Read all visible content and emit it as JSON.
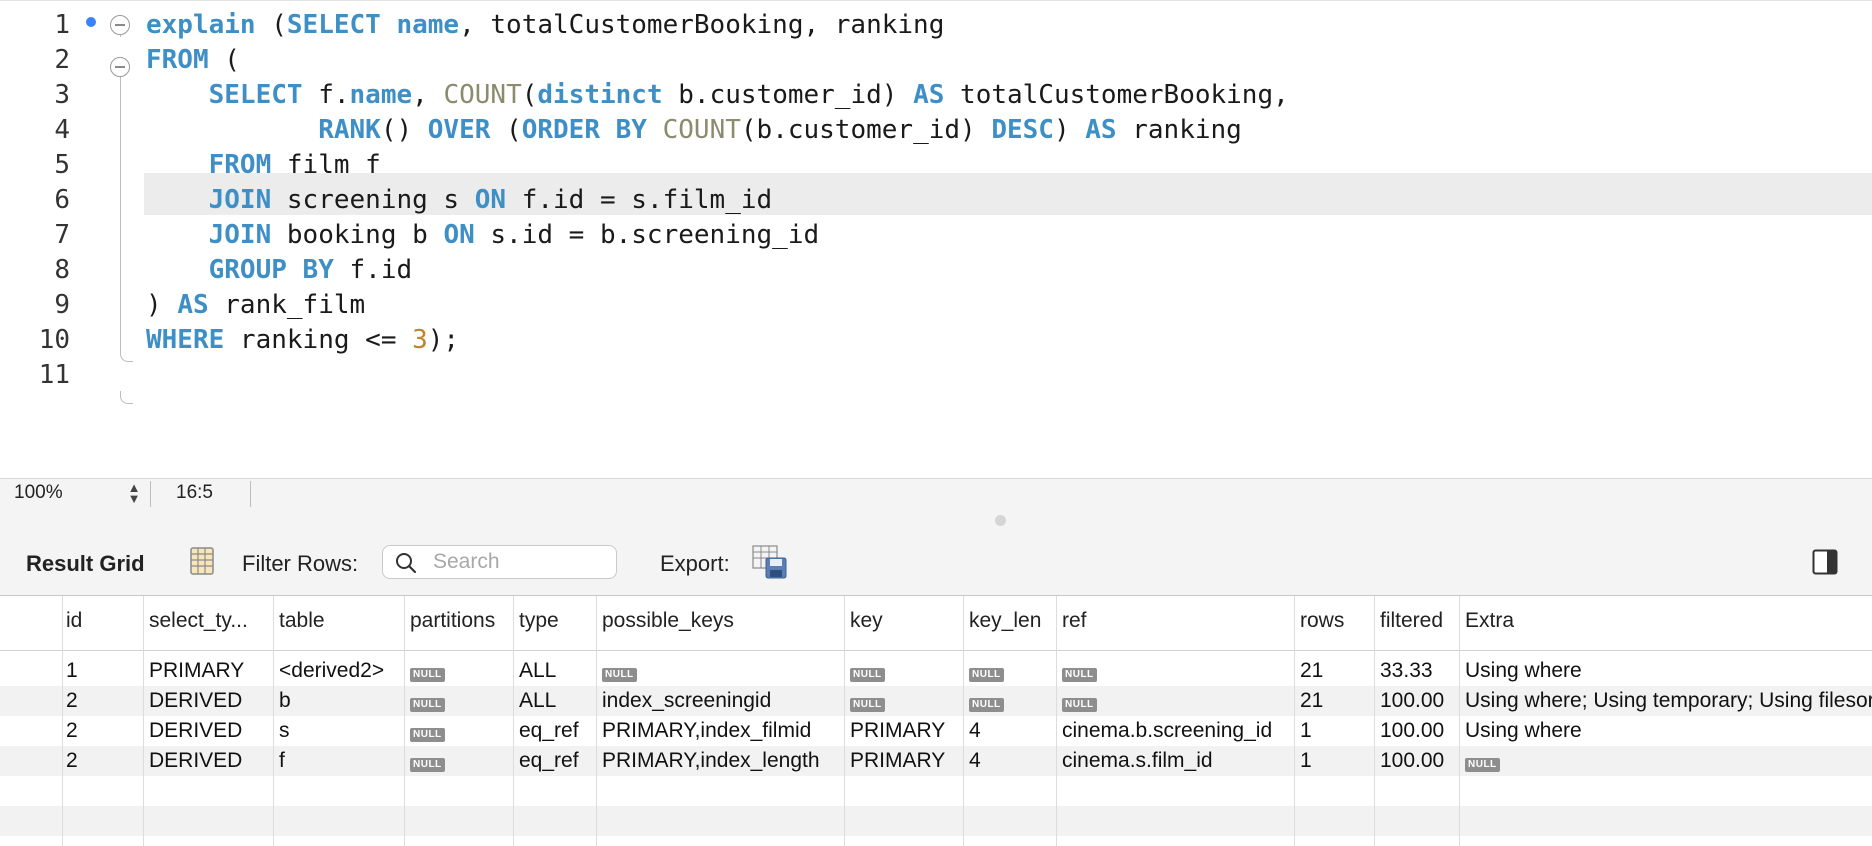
{
  "editor": {
    "line_numbers": [
      "1",
      "2",
      "3",
      "4",
      "5",
      "6",
      "7",
      "8",
      "9",
      "10",
      "11"
    ],
    "lines": [
      [
        {
          "t": "explain",
          "c": "kw"
        },
        {
          "t": " ("
        },
        {
          "t": "SELECT",
          "c": "kw"
        },
        {
          "t": " "
        },
        {
          "t": "name",
          "c": "kw"
        },
        {
          "t": ", totalCustomerBooking, ranking"
        }
      ],
      [
        {
          "t": "FROM",
          "c": "kw"
        },
        {
          "t": " ("
        }
      ],
      [
        {
          "t": "    "
        },
        {
          "t": "SELECT",
          "c": "kw"
        },
        {
          "t": " f."
        },
        {
          "t": "name",
          "c": "kw"
        },
        {
          "t": ", "
        },
        {
          "t": "COUNT",
          "c": "fn"
        },
        {
          "t": "("
        },
        {
          "t": "distinct",
          "c": "kw"
        },
        {
          "t": " b.customer_id) "
        },
        {
          "t": "AS",
          "c": "kw"
        },
        {
          "t": " totalCustomerBooking,"
        }
      ],
      [
        {
          "t": "           "
        },
        {
          "t": "RANK",
          "c": "kw"
        },
        {
          "t": "() "
        },
        {
          "t": "OVER",
          "c": "kw"
        },
        {
          "t": " ("
        },
        {
          "t": "ORDER BY",
          "c": "kw"
        },
        {
          "t": " "
        },
        {
          "t": "COUNT",
          "c": "fn"
        },
        {
          "t": "(b.customer_id) "
        },
        {
          "t": "DESC",
          "c": "kw"
        },
        {
          "t": ") "
        },
        {
          "t": "AS",
          "c": "kw"
        },
        {
          "t": " ranking"
        }
      ],
      [
        {
          "t": "    "
        },
        {
          "t": "FROM",
          "c": "kw"
        },
        {
          "t": " film f"
        }
      ],
      [
        {
          "t": "    "
        },
        {
          "t": "JOIN",
          "c": "kw"
        },
        {
          "t": " screening s "
        },
        {
          "t": "ON",
          "c": "kw"
        },
        {
          "t": " f.id = s.film_id"
        }
      ],
      [
        {
          "t": "    "
        },
        {
          "t": "JOIN",
          "c": "kw"
        },
        {
          "t": " booking b "
        },
        {
          "t": "ON",
          "c": "kw"
        },
        {
          "t": " s.id = b.screening_id"
        }
      ],
      [
        {
          "t": "    "
        },
        {
          "t": "GROUP BY",
          "c": "kw"
        },
        {
          "t": " f.id"
        }
      ],
      [
        {
          "t": ") "
        },
        {
          "t": "AS",
          "c": "kw"
        },
        {
          "t": " rank_film"
        }
      ],
      [
        {
          "t": "WHERE",
          "c": "kw"
        },
        {
          "t": " ranking <= "
        },
        {
          "t": "3",
          "c": "num"
        },
        {
          "t": ");"
        }
      ],
      []
    ]
  },
  "status": {
    "zoom": "100%",
    "cursor": "16:5"
  },
  "result_toolbar": {
    "title": "Result Grid",
    "filter_label": "Filter Rows:",
    "search_placeholder": "Search",
    "export_label": "Export:"
  },
  "grid": {
    "null_label": "NULL",
    "columns": [
      "id",
      "select_ty...",
      "table",
      "partitions",
      "type",
      "possible_keys",
      "key",
      "key_len",
      "ref",
      "rows",
      "filtered",
      "Extra"
    ],
    "rows": [
      [
        "1",
        "PRIMARY",
        "<derived2>",
        null,
        "ALL",
        null,
        null,
        null,
        null,
        "21",
        "33.33",
        "Using where"
      ],
      [
        "2",
        "DERIVED",
        "b",
        null,
        "ALL",
        "index_screeningid",
        null,
        null,
        null,
        "21",
        "100.00",
        "Using where; Using temporary; Using filesort"
      ],
      [
        "2",
        "DERIVED",
        "s",
        null,
        "eq_ref",
        "PRIMARY,index_filmid",
        "PRIMARY",
        "4",
        "cinema.b.screening_id",
        "1",
        "100.00",
        "Using where"
      ],
      [
        "2",
        "DERIVED",
        "f",
        null,
        "eq_ref",
        "PRIMARY,index_length",
        "PRIMARY",
        "4",
        "cinema.s.film_id",
        "1",
        "100.00",
        null
      ]
    ]
  }
}
